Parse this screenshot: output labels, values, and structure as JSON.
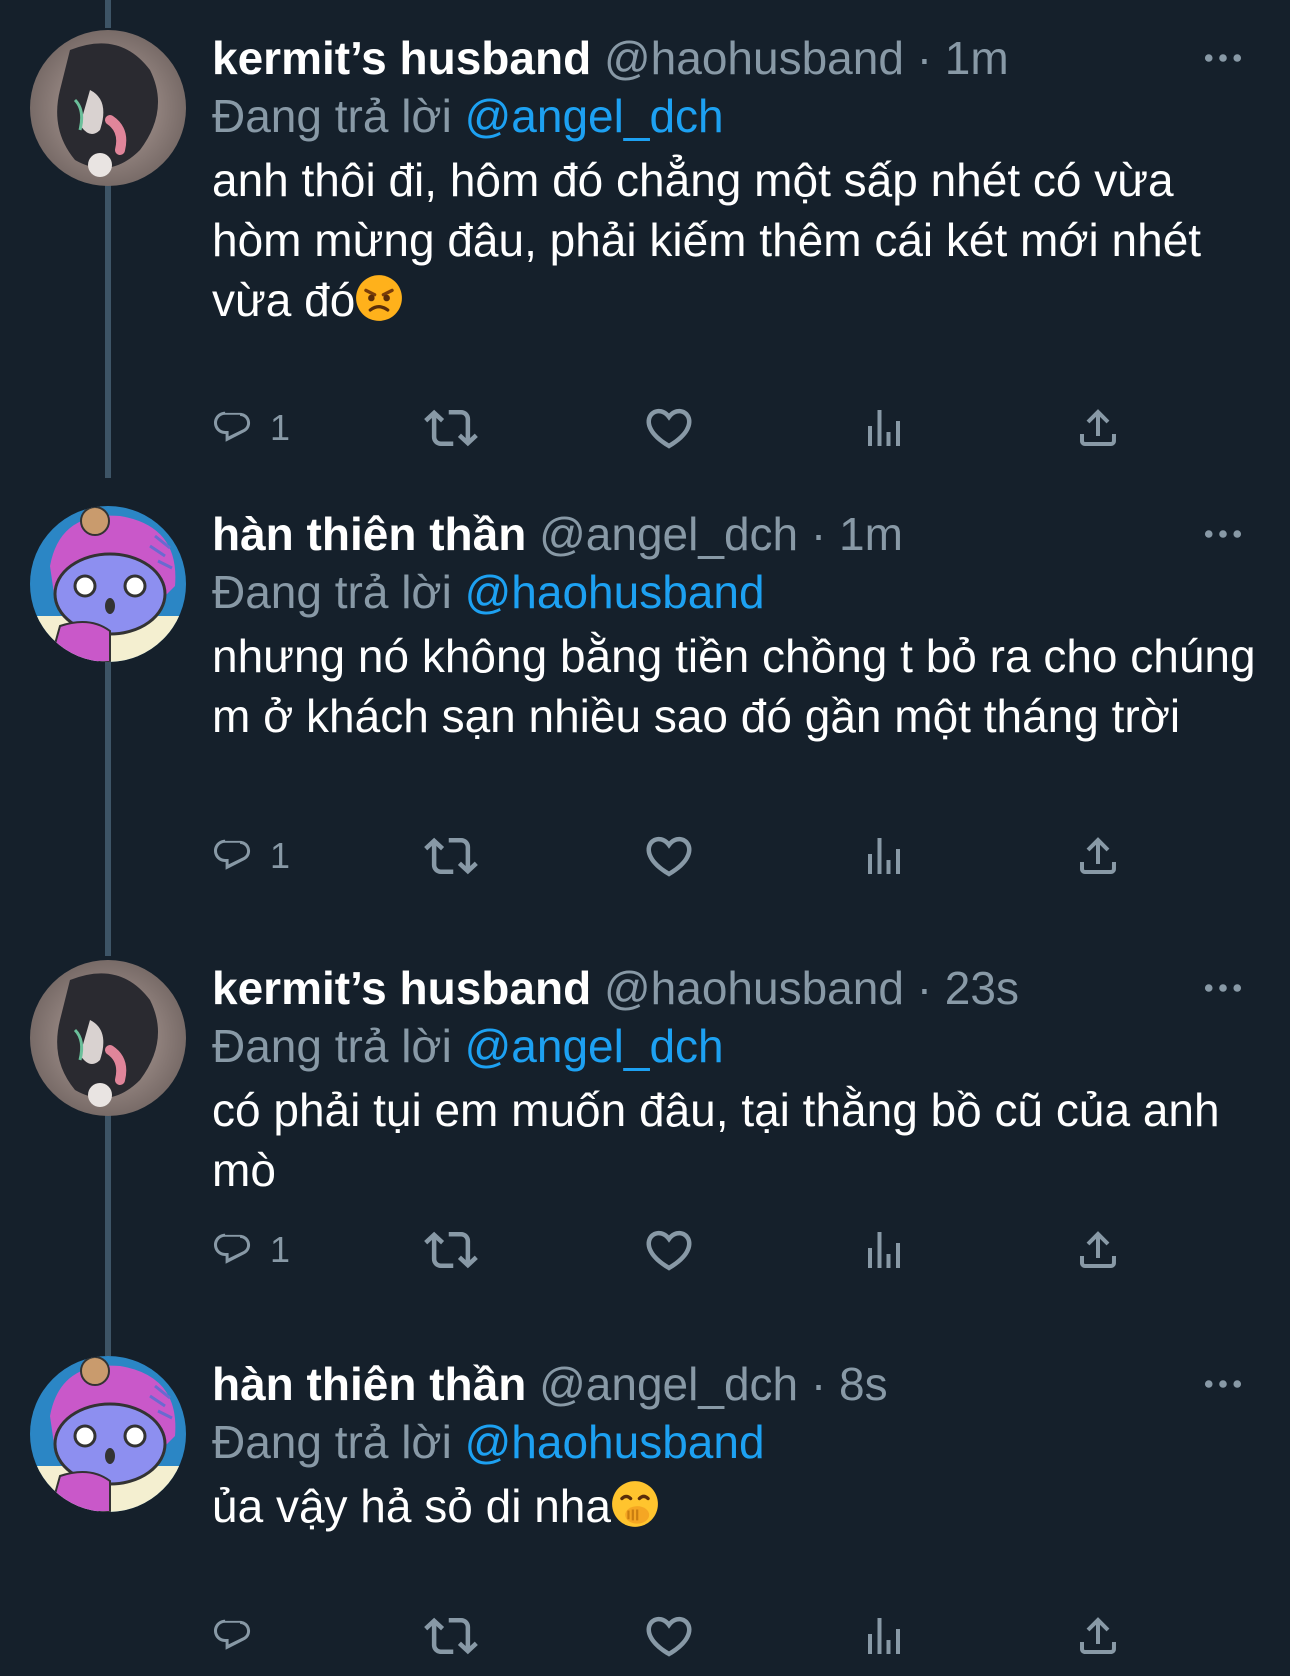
{
  "tweets": [
    {
      "name": "kermit’s husband",
      "handle": "@haohusband",
      "time": "1m",
      "replying_label": "Đang trả lời",
      "replying_to": "@angel_dch",
      "text": "anh thôi đi, hôm đó chẳng một sấp nhét có vừa hòm mừng đâu, phải kiếm thêm cái két mới nhét vừa đó",
      "emoji": "angry-face",
      "reply_count": "1"
    },
    {
      "name": "hàn thiên thần",
      "handle": "@angel_dch",
      "time": "1m",
      "replying_label": "Đang trả lời",
      "replying_to": "@haohusband",
      "text": "nhưng nó không bằng tiền chồng t bỏ ra cho chúng m ở khách sạn nhiều sao đó gần một tháng trời",
      "reply_count": "1"
    },
    {
      "name": "kermit’s husband",
      "handle": "@haohusband",
      "time": "23s",
      "replying_label": "Đang trả lời",
      "replying_to": "@angel_dch",
      "text": "có phải tụi em muốn đâu, tại thằng bồ cũ của anh mò",
      "reply_count": "1"
    },
    {
      "name": "hàn thiên thần",
      "handle": "@angel_dch",
      "time": "8s",
      "replying_label": "Đang trả lời",
      "replying_to": "@haohusband",
      "text": "ủa vậy hả sỏ di nha",
      "emoji": "face-with-hand-over-mouth",
      "reply_count": ""
    }
  ],
  "separator": "·",
  "icons": [
    "reply-icon",
    "retweet-icon",
    "like-icon",
    "analytics-icon",
    "share-icon",
    "more-icon"
  ],
  "colors": {
    "background": "#15202b",
    "text": "#ffffff",
    "secondary": "#8899a6",
    "link": "#1da1f2",
    "thread_line": "#3d5466"
  }
}
